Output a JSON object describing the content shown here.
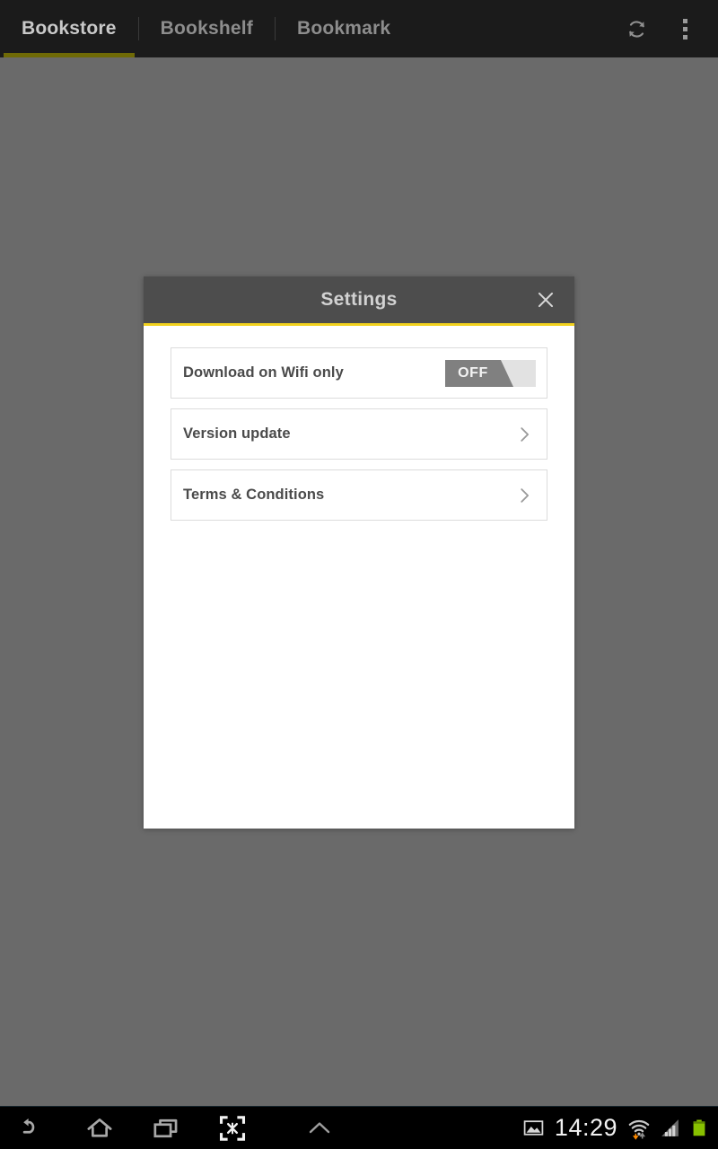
{
  "app_bar": {
    "tabs": [
      {
        "label": "Bookstore",
        "active": true
      },
      {
        "label": "Bookshelf",
        "active": false
      },
      {
        "label": "Bookmark",
        "active": false
      }
    ],
    "actions": [
      {
        "name": "refresh-icon",
        "label": "Refresh"
      },
      {
        "name": "overflow-menu-icon",
        "label": "More options"
      }
    ],
    "active_tab_underline_color": "#6f6a06",
    "background_color": "#1b1b1b"
  },
  "scrim": {
    "color": "#6a6a6a"
  },
  "dialog": {
    "title": "Settings",
    "close_label": "×",
    "header_color": "#4d4d4d",
    "accent_color": "#f2d21e",
    "body_color": "#ffffff",
    "rows": [
      {
        "label": "Download on Wifi only",
        "control": "toggle",
        "toggle_value": "OFF",
        "toggle_on": false
      },
      {
        "label": "Version update",
        "control": "chevron"
      },
      {
        "label": "Terms & Conditions",
        "control": "chevron"
      }
    ]
  },
  "system_bar": {
    "nav_buttons": [
      {
        "name": "back-icon",
        "label": "Back"
      },
      {
        "name": "home-icon",
        "label": "Home"
      },
      {
        "name": "recent-apps-icon",
        "label": "Recent apps"
      },
      {
        "name": "screenshot-icon",
        "label": "Screenshot"
      },
      {
        "name": "chevron-up-icon",
        "label": "Expand"
      }
    ],
    "status": {
      "time": "14:29",
      "icons": [
        {
          "name": "image-icon",
          "label": "Screenshot captured"
        },
        {
          "name": "wifi-icon",
          "label": "Wi-Fi connected"
        },
        {
          "name": "signal-icon",
          "label": "Signal strength"
        },
        {
          "name": "battery-icon",
          "label": "Battery"
        }
      ],
      "battery_color": "#88c100",
      "wifi_activity_color": "#ff8a00"
    }
  }
}
